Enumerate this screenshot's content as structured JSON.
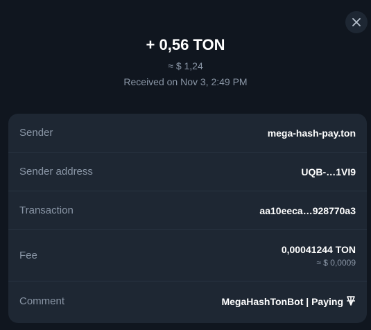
{
  "header": {
    "amount": "+ 0,56 TON",
    "fiat": "≈ $ 1,24",
    "received": "Received on Nov 3, 2:49 PM"
  },
  "close_icon": "close-icon",
  "details": {
    "sender": {
      "label": "Sender",
      "value": "mega-hash-pay.ton"
    },
    "sender_address": {
      "label": "Sender address",
      "value": "UQB-…1VI9"
    },
    "transaction": {
      "label": "Transaction",
      "value": "aa10eeca…928770a3"
    },
    "fee": {
      "label": "Fee",
      "value": "0,00041244 TON",
      "fiat": "≈ $ 0,0009"
    },
    "comment": {
      "label": "Comment",
      "value": "MegaHashTonBot | Paying",
      "icon": "ton-currency-icon"
    }
  },
  "colors": {
    "background": "#10161f",
    "card": "#1e2733",
    "muted_text": "#8a96a6",
    "divider": "#2a3442"
  }
}
